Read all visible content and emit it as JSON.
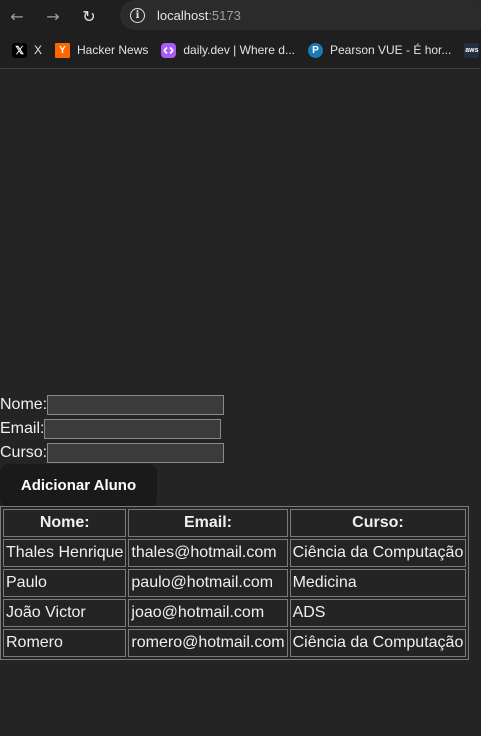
{
  "browser": {
    "url_host": "localhost",
    "url_port": ":5173",
    "bookmarks": [
      {
        "label": "X",
        "icon": "x-logo-icon"
      },
      {
        "label": "Hacker News",
        "icon": "hacker-news-icon",
        "glyph": "Y"
      },
      {
        "label": "daily.dev | Where d...",
        "icon": "daily-dev-icon"
      },
      {
        "label": "Pearson VUE - É hor...",
        "icon": "pearson-icon",
        "glyph": "P"
      },
      {
        "label": "",
        "icon": "aws-icon",
        "glyph": "aws"
      }
    ]
  },
  "form": {
    "nome_label": "Nome:",
    "email_label": "Email:",
    "curso_label": "Curso:",
    "nome_value": "",
    "email_value": "",
    "curso_value": "",
    "submit_label": "Adicionar Aluno"
  },
  "table": {
    "headers": [
      "Nome:",
      "Email:",
      "Curso:"
    ],
    "rows": [
      [
        "Thales Henrique",
        "thales@hotmail.com",
        "Ciência da Computação"
      ],
      [
        "Paulo",
        "paulo@hotmail.com",
        "Medicina"
      ],
      [
        "João Victor",
        "joao@hotmail.com",
        "ADS"
      ],
      [
        "Romero",
        "romero@hotmail.com",
        "Ciência da Computação"
      ]
    ]
  }
}
